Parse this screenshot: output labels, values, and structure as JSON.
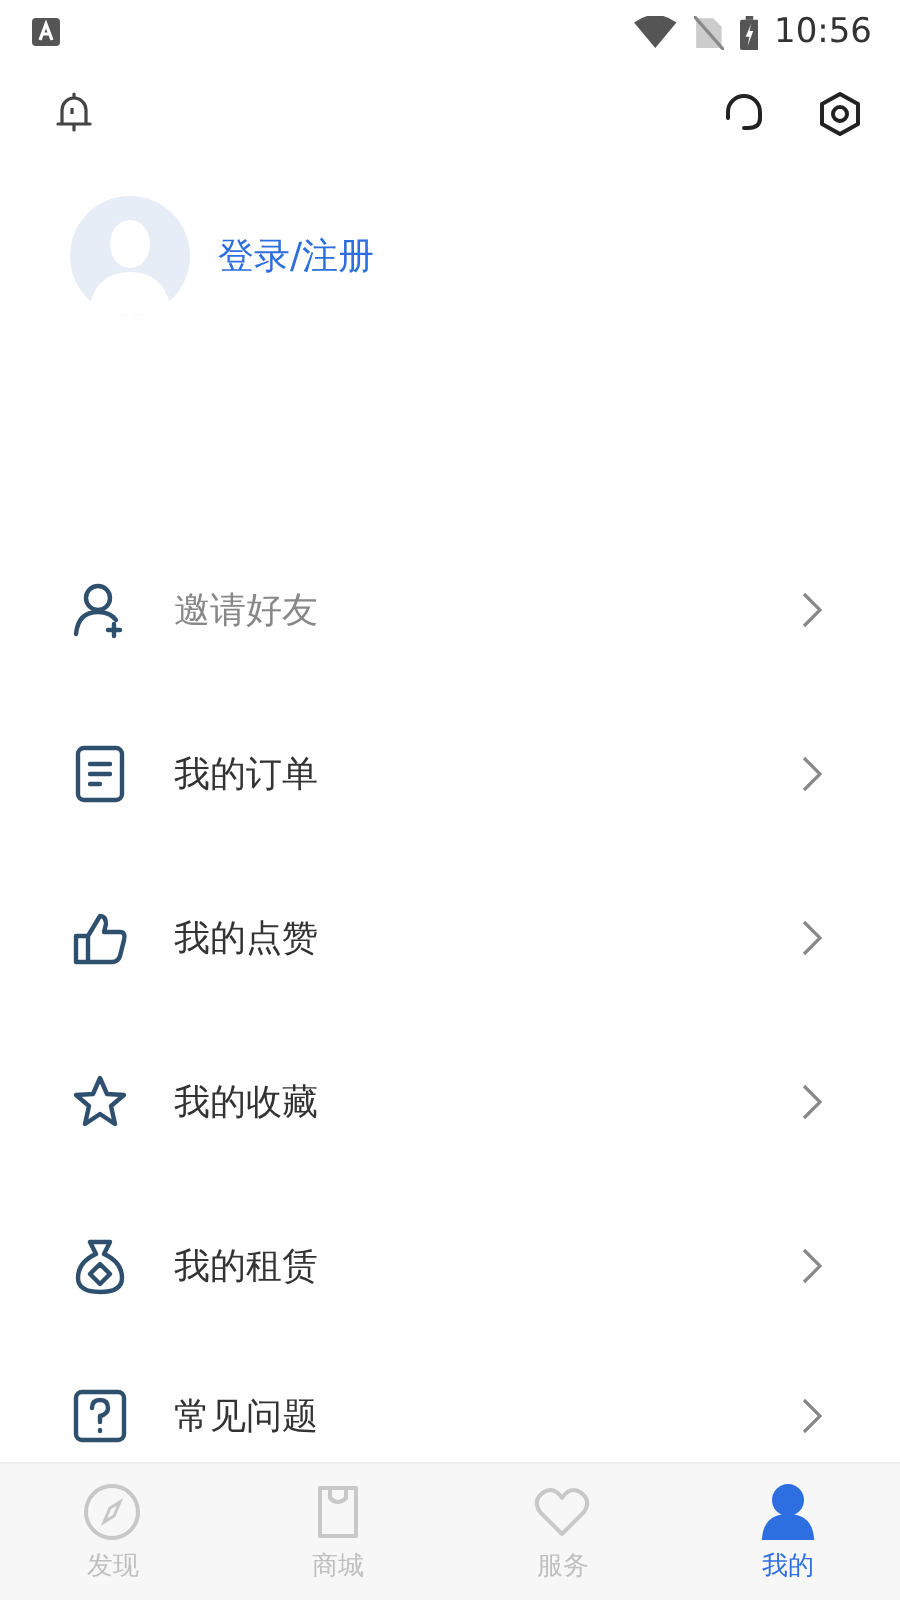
{
  "status_bar": {
    "time": "10:56"
  },
  "login": {
    "label": "登录/注册"
  },
  "menu": [
    {
      "kind": "invite",
      "label": "邀请好友",
      "muted": true
    },
    {
      "kind": "orders",
      "label": "我的订单",
      "muted": false
    },
    {
      "kind": "likes",
      "label": "我的点赞",
      "muted": false
    },
    {
      "kind": "favorites",
      "label": "我的收藏",
      "muted": false
    },
    {
      "kind": "rental",
      "label": "我的租赁",
      "muted": false
    },
    {
      "kind": "faq",
      "label": "常见问题",
      "muted": false
    }
  ],
  "tabs": [
    {
      "kind": "discover",
      "label": "发现",
      "selected": false
    },
    {
      "kind": "shop",
      "label": "商城",
      "selected": false
    },
    {
      "kind": "service",
      "label": "服务",
      "selected": false
    },
    {
      "kind": "me",
      "label": "我的",
      "selected": true
    }
  ]
}
